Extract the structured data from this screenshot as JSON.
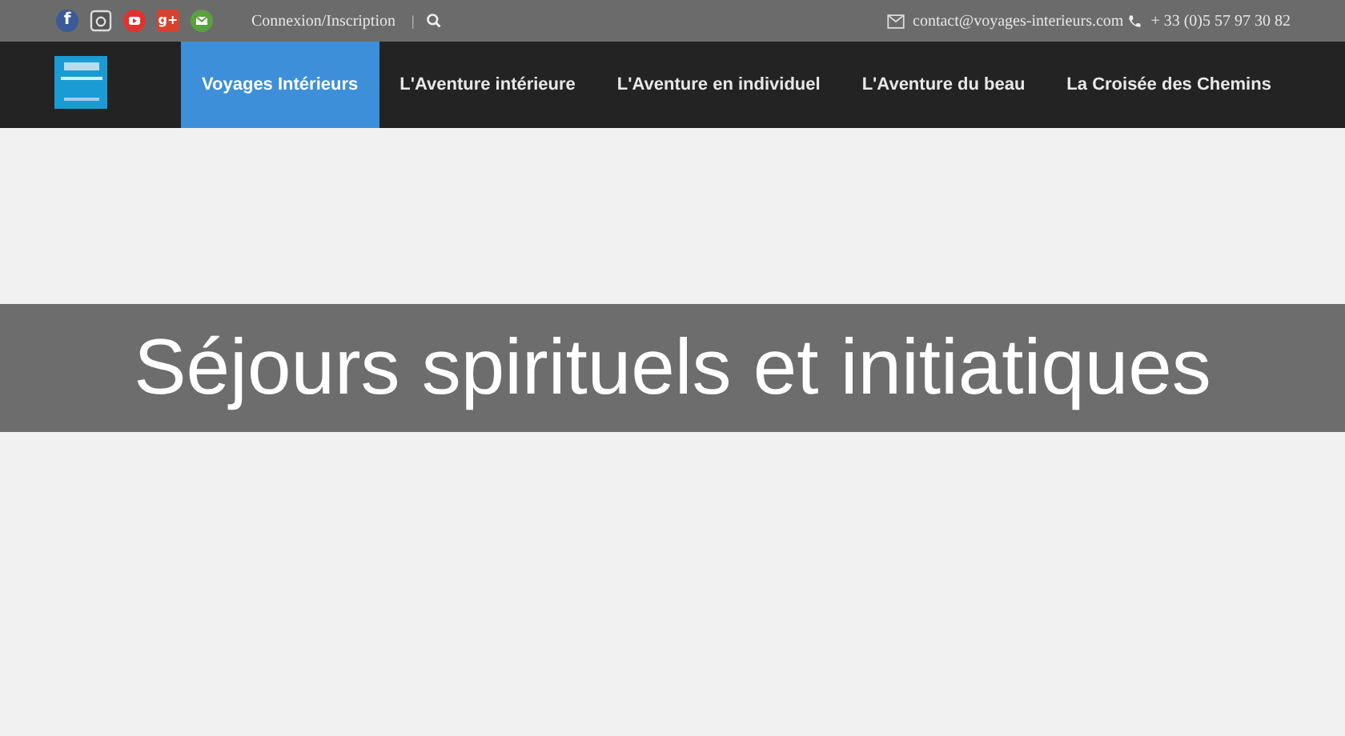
{
  "topbar": {
    "social": [
      {
        "kind": "facebook",
        "glyph": "f"
      },
      {
        "kind": "instagram"
      },
      {
        "kind": "youtube"
      },
      {
        "kind": "googleplus",
        "glyph": "g+"
      },
      {
        "kind": "email"
      }
    ],
    "login_link": "Connexion/Inscription",
    "separator": "|",
    "email": "contact@voyages-interieurs.com",
    "phone": "+ 33 (0)5 57 97 30 82"
  },
  "nav": {
    "items": [
      {
        "label": "Voyages Intérieurs",
        "selected": true
      },
      {
        "label": "L'Aventure intérieure",
        "selected": false
      },
      {
        "label": "L'Aventure en individuel",
        "selected": false
      },
      {
        "label": "L'Aventure du beau",
        "selected": false
      },
      {
        "label": "La Croisée des Chemins",
        "selected": false
      }
    ]
  },
  "banner": {
    "title": "Séjours spirituels et initiatiques"
  }
}
